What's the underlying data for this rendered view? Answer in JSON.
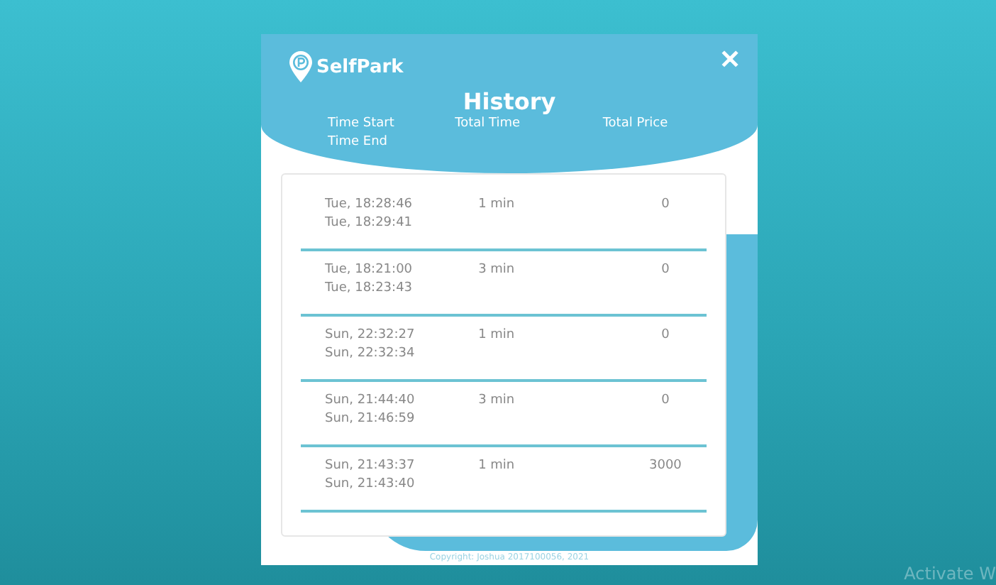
{
  "brand": "SelfPark",
  "close": "✕",
  "title": "History",
  "columns": [
    {
      "lines": [
        "Time Start",
        "Time End"
      ]
    },
    {
      "lines": [
        "Total Time"
      ]
    },
    {
      "lines": [
        "Total Price"
      ]
    }
  ],
  "rows": [
    {
      "start": "Tue, 18:28:46",
      "end": "Tue, 18:29:41",
      "total_time": "1 min",
      "total_price": "0"
    },
    {
      "start": "Tue, 18:21:00",
      "end": "Tue, 18:23:43",
      "total_time": "3 min",
      "total_price": "0"
    },
    {
      "start": "Sun, 22:32:27",
      "end": "Sun, 22:32:34",
      "total_time": "1 min",
      "total_price": "0"
    },
    {
      "start": "Sun, 21:44:40",
      "end": "Sun, 21:46:59",
      "total_time": "3 min",
      "total_price": "0"
    },
    {
      "start": "Sun, 21:43:37",
      "end": "Sun, 21:43:40",
      "total_time": "1 min",
      "total_price": "3000"
    }
  ],
  "footer": "Copyright: Joshua 2017100056, 2021",
  "overlay": "Activate W"
}
